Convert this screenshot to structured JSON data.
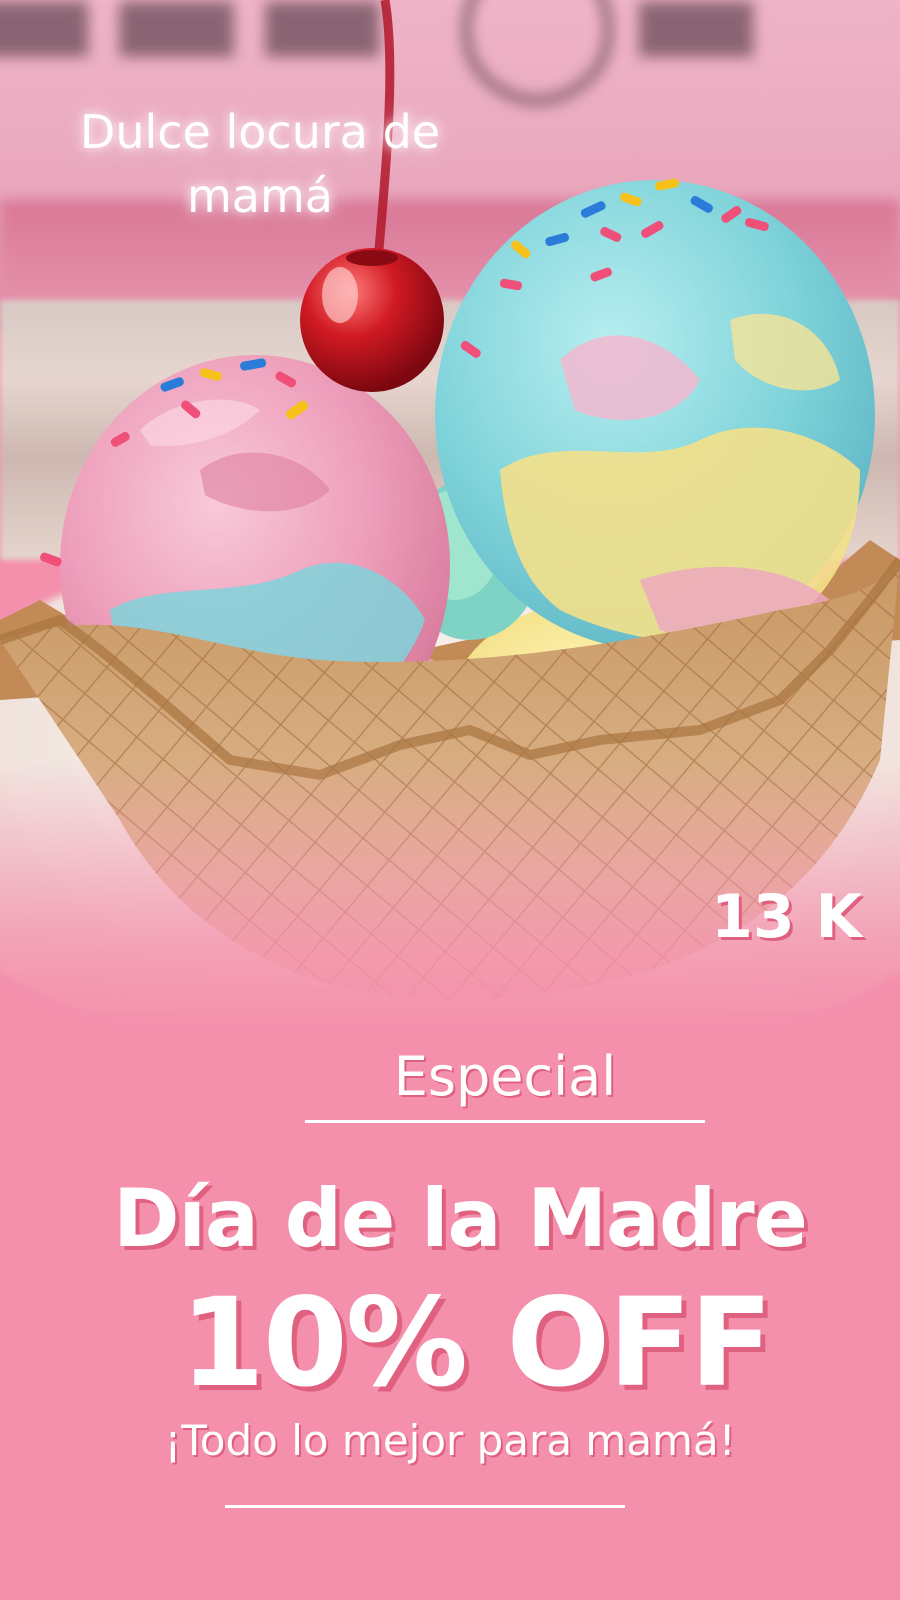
{
  "poster": {
    "tagline": "Dulce locura de mamá",
    "price": "13 K",
    "special_label": "Especial",
    "event_title": "Día de la Madre",
    "discount": "10% OFF",
    "subtitle": "¡Todo lo mejor para mamá!"
  },
  "colors": {
    "background_pink": "#f48fac",
    "text": "#ffffff",
    "text_shadow": "#e0607f"
  },
  "illustration": {
    "subject": "ice-cream-waffle-bowl-image",
    "items": [
      "cherry-icon",
      "sprinkles-icon",
      "ice-cream-scoop",
      "waffle-bowl"
    ]
  }
}
